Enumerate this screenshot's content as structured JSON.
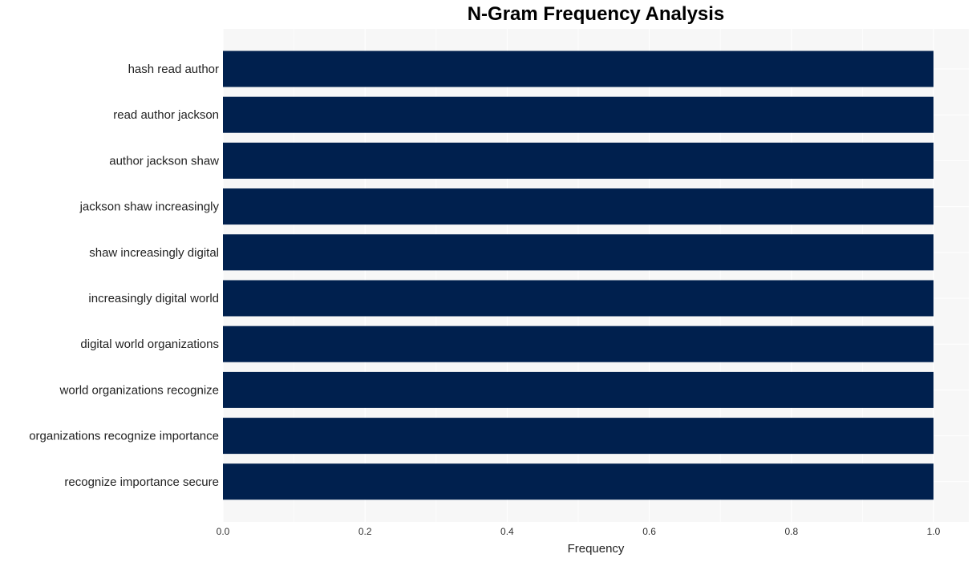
{
  "chart_data": {
    "type": "bar",
    "orientation": "horizontal",
    "title": "N-Gram Frequency Analysis",
    "xlabel": "Frequency",
    "ylabel": "",
    "categories": [
      "hash read author",
      "read author jackson",
      "author jackson shaw",
      "jackson shaw increasingly",
      "shaw increasingly digital",
      "increasingly digital world",
      "digital world organizations",
      "world organizations recognize",
      "organizations recognize importance",
      "recognize importance secure"
    ],
    "values": [
      1,
      1,
      1,
      1,
      1,
      1,
      1,
      1,
      1,
      1
    ],
    "xlim": [
      0,
      1.05
    ],
    "xticks": [
      "0.0",
      "0.2",
      "0.4",
      "0.6",
      "0.8",
      "1.0"
    ],
    "grid": true,
    "bar_color": "#00204e",
    "panel_color": "#f7f7f7"
  }
}
